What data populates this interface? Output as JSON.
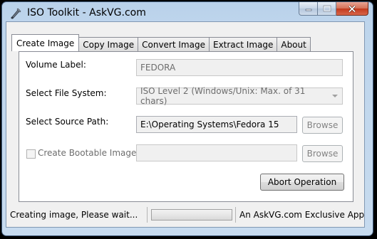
{
  "window": {
    "title": "ISO Toolkit - AskVG.com",
    "buttons": {
      "minimize": "—",
      "maximize": "□",
      "close": "✕"
    }
  },
  "tabs": [
    {
      "label": "Create Image",
      "active": true
    },
    {
      "label": "Copy Image",
      "active": false
    },
    {
      "label": "Convert Image",
      "active": false
    },
    {
      "label": "Extract Image",
      "active": false
    },
    {
      "label": "About",
      "active": false
    }
  ],
  "form": {
    "volume_label": {
      "label": "Volume Label:",
      "value": "FEDORA"
    },
    "file_system": {
      "label": "Select File System:",
      "value": "ISO Level 2 (Windows/Unix: Max. of 31 chars)"
    },
    "source_path": {
      "label": "Select Source Path:",
      "value": "E:\\Operating Systems\\Fedora 15",
      "browse": "Browse"
    },
    "bootable": {
      "label": "Create Bootable Image",
      "checked": false,
      "value": "",
      "browse": "Browse"
    },
    "abort_button": "Abort Operation"
  },
  "status": {
    "message": "Creating image, Please wait...",
    "progress": 0.0,
    "right_text": "An AskVG.com Exclusive App"
  },
  "colors": {
    "title_bar": "#bed5ec",
    "close_button": "#c2391c",
    "client_background": "#f0f0f0"
  }
}
